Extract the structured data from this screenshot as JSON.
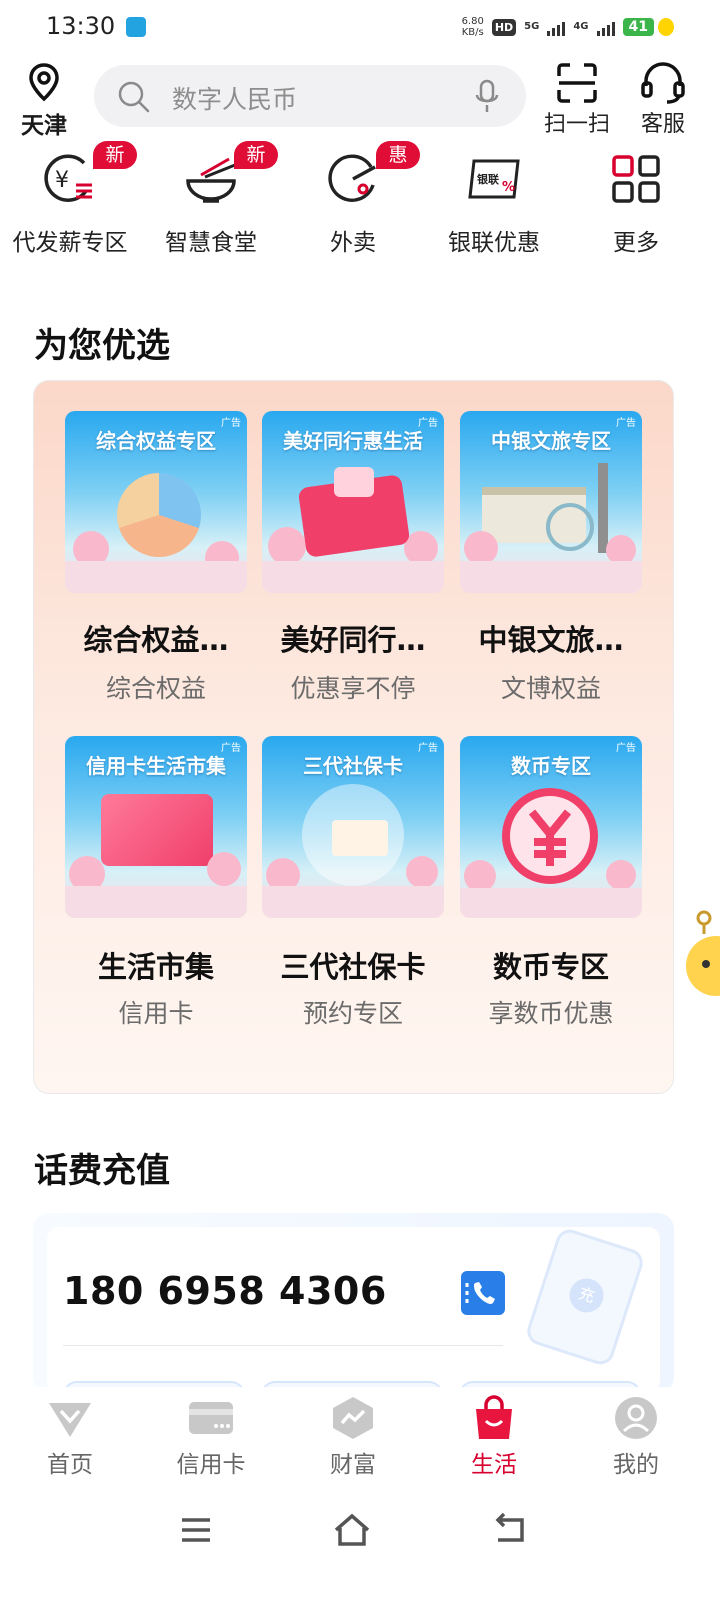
{
  "status_bar": {
    "time": "13:30",
    "speed_value": "6.80",
    "speed_unit": "KB/s",
    "hd": "HD",
    "network_a": "5G",
    "network_b": "4G",
    "battery": "41"
  },
  "header": {
    "location": "天津",
    "search_placeholder": "数字人民币",
    "scan_label": "扫一扫",
    "service_label": "客服"
  },
  "quick_entries": [
    {
      "label": "代发薪专区",
      "badge": "新",
      "icon": "yuan-salary-icon"
    },
    {
      "label": "智慧食堂",
      "badge": "新",
      "icon": "bowl-chopsticks-icon"
    },
    {
      "label": "外卖",
      "badge": "惠",
      "icon": "delivery-icon"
    },
    {
      "label": "银联优惠",
      "badge": "",
      "icon": "unionpay-card-icon",
      "icon_text": "银联%"
    },
    {
      "label": "更多",
      "badge": "",
      "icon": "grid-more-icon"
    }
  ],
  "recommend": {
    "title": "为您优选",
    "ad_tag": "广告",
    "items": [
      {
        "image_title": "综合权益专区",
        "name": "综合权益…",
        "sub": "综合权益"
      },
      {
        "image_title": "美好同行惠生活",
        "name": "美好同行…",
        "sub": "优惠享不停"
      },
      {
        "image_title": "中银文旅专区",
        "name": "中银文旅…",
        "sub": "文博权益"
      },
      {
        "image_title": "信用卡生活市集",
        "name": "生活市集",
        "sub": "信用卡"
      },
      {
        "image_title": "三代社保卡",
        "name": "三代社保卡",
        "sub": "预约专区"
      },
      {
        "image_title": "数币专区",
        "name": "数币专区",
        "sub": "享数币优惠"
      }
    ]
  },
  "recharge": {
    "title": "话费充值",
    "phone": "180 6958 4306",
    "deco_text": "充"
  },
  "bottom_nav": {
    "items": [
      {
        "label": "首页",
        "icon": "diamond-home-icon",
        "active": false
      },
      {
        "label": "信用卡",
        "icon": "credit-card-icon",
        "active": false
      },
      {
        "label": "财富",
        "icon": "wealth-chart-icon",
        "active": false
      },
      {
        "label": "生活",
        "icon": "shopping-bag-icon",
        "active": true
      },
      {
        "label": "我的",
        "icon": "user-profile-icon",
        "active": false
      }
    ]
  },
  "colors": {
    "brand_red": "#d7002f",
    "badge_red": "#e00d36",
    "contact_blue": "#2a7ee8"
  }
}
